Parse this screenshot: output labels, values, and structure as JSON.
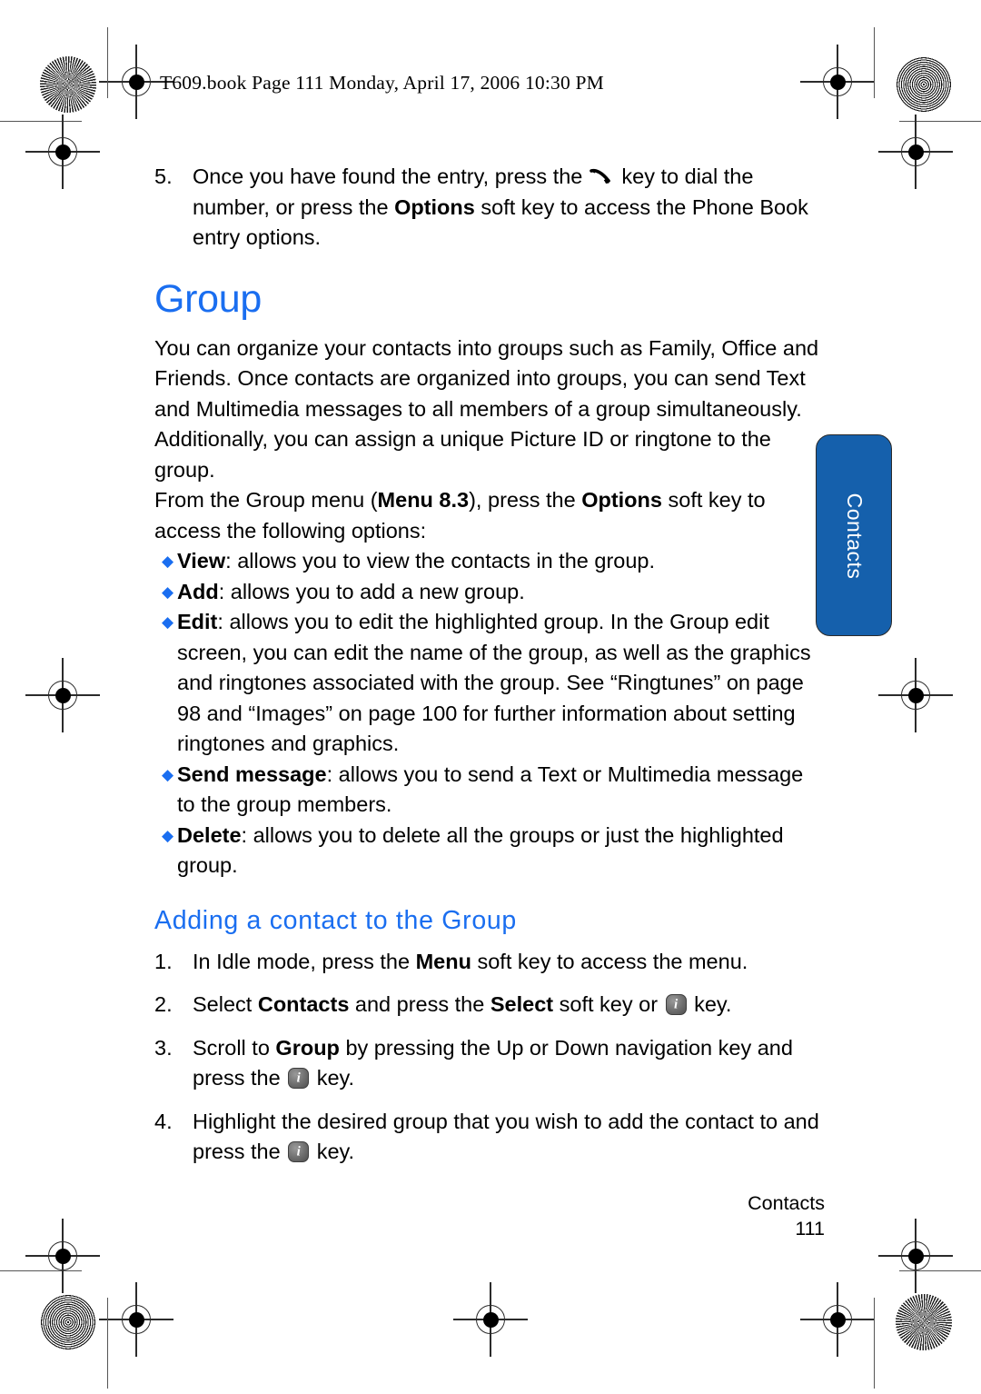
{
  "header": {
    "line": "T609.book  Page 111  Monday, April 17, 2006  10:30 PM"
  },
  "steps_top": [
    {
      "num": "5.",
      "parts": [
        {
          "t": "Once you have found the entry, press the "
        },
        {
          "icon": "send-key-icon"
        },
        {
          "t": " key to dial the number, or press the "
        },
        {
          "t": "Options",
          "b": true
        },
        {
          "t": " soft key to access the Phone Book entry options."
        }
      ]
    }
  ],
  "section": {
    "heading": "Group",
    "paragraph1": "You can organize your contacts into groups such as Family, Office and Friends. Once contacts are organized into groups, you can send Text and Multimedia messages to all members of a group simultaneously. Additionally, you can assign a unique Picture ID or ringtone to the group.",
    "paragraph2_parts": [
      {
        "t": "From the Group menu ("
      },
      {
        "t": "Menu 8.3",
        "b": true
      },
      {
        "t": "), press the "
      },
      {
        "t": "Options",
        "b": true
      },
      {
        "t": " soft key to access the following options:"
      }
    ]
  },
  "options_bullets": [
    {
      "bullet": "◆",
      "label": "View",
      "text": ": allows you to view the contacts in the group."
    },
    {
      "bullet": "◆",
      "label": "Add",
      "text": ": allows you to add a new group."
    },
    {
      "bullet": "◆",
      "label": "Edit",
      "text": ": allows you to edit the highlighted group. In the Group edit screen, you can edit the name of the group, as well as the graphics and ringtones associated with the group. See “Ringtunes” on page 98 and “Images” on page 100 for further information about setting ringtones and graphics."
    },
    {
      "bullet": "◆",
      "label": "Send message",
      "text": ": allows you to send a Text or Multimedia message to the group members."
    },
    {
      "bullet": "◆",
      "label": "Delete",
      "text": ": allows you to delete all the groups or just the highlighted group."
    }
  ],
  "subsection": {
    "heading": "Adding a contact to the Group"
  },
  "steps_bottom": [
    {
      "num": "1.",
      "parts": [
        {
          "t": "In Idle mode, press the "
        },
        {
          "t": "Menu",
          "b": true
        },
        {
          "t": " soft key to access the menu."
        }
      ]
    },
    {
      "num": "2.",
      "parts": [
        {
          "t": "Select "
        },
        {
          "t": "Contacts",
          "b": true
        },
        {
          "t": " and press the "
        },
        {
          "t": "Select",
          "b": true
        },
        {
          "t": " soft key or "
        },
        {
          "icon": "i-key-icon"
        },
        {
          "t": " key."
        }
      ]
    },
    {
      "num": "3.",
      "parts": [
        {
          "t": "Scroll to "
        },
        {
          "t": "Group",
          "b": true
        },
        {
          "t": " by pressing the Up or Down navigation key and press the "
        },
        {
          "icon": "i-key-icon"
        },
        {
          "t": " key."
        }
      ]
    },
    {
      "num": "4.",
      "parts": [
        {
          "t": "Highlight the desired group that you wish to add the contact to and press the "
        },
        {
          "icon": "i-key-icon"
        },
        {
          "t": " key."
        }
      ]
    }
  ],
  "side_tab": {
    "label": "Contacts",
    "color": "#1560ac"
  },
  "footer": {
    "section": "Contacts",
    "page": "111"
  },
  "colors": {
    "heading_blue": "#1a6ef0",
    "bullet_blue": "#1a6ef0",
    "tab_blue": "#1560ac"
  }
}
